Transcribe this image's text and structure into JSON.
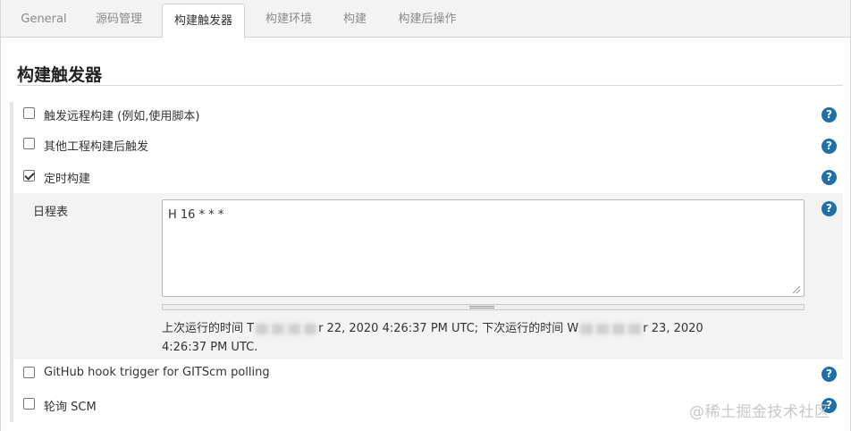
{
  "tabs": [
    {
      "label": "General",
      "active": false
    },
    {
      "label": "源码管理",
      "active": false
    },
    {
      "label": "构建触发器",
      "active": true
    },
    {
      "label": "构建环境",
      "active": false
    },
    {
      "label": "构建",
      "active": false
    },
    {
      "label": "构建后操作",
      "active": false
    }
  ],
  "section": {
    "title": "构建触发器"
  },
  "triggers": [
    {
      "label": "触发远程构建 (例如,使用脚本)",
      "checked": false
    },
    {
      "label": "其他工程构建后触发",
      "checked": false
    },
    {
      "label": "定时构建",
      "checked": true
    },
    {
      "label": "GitHub hook trigger for GITScm polling",
      "checked": false
    },
    {
      "label": "轮询 SCM",
      "checked": false
    }
  ],
  "schedule": {
    "label": "日程表",
    "value": "H 16 * * *",
    "last_run_prefix": "上次运行的时间 T",
    "last_run_suffix": "r 22, 2020 4:26:37 PM UTC; 下次运行的时间 W",
    "next_run_suffix": "r 23, 2020",
    "next_run_line2": "4:26:37 PM UTC."
  },
  "help_icon": "question-mark-icon",
  "watermark": "@稀土掘金技术社区",
  "colors": {
    "help": "#1f6fa8",
    "tab_bg": "#f3f3f3"
  }
}
